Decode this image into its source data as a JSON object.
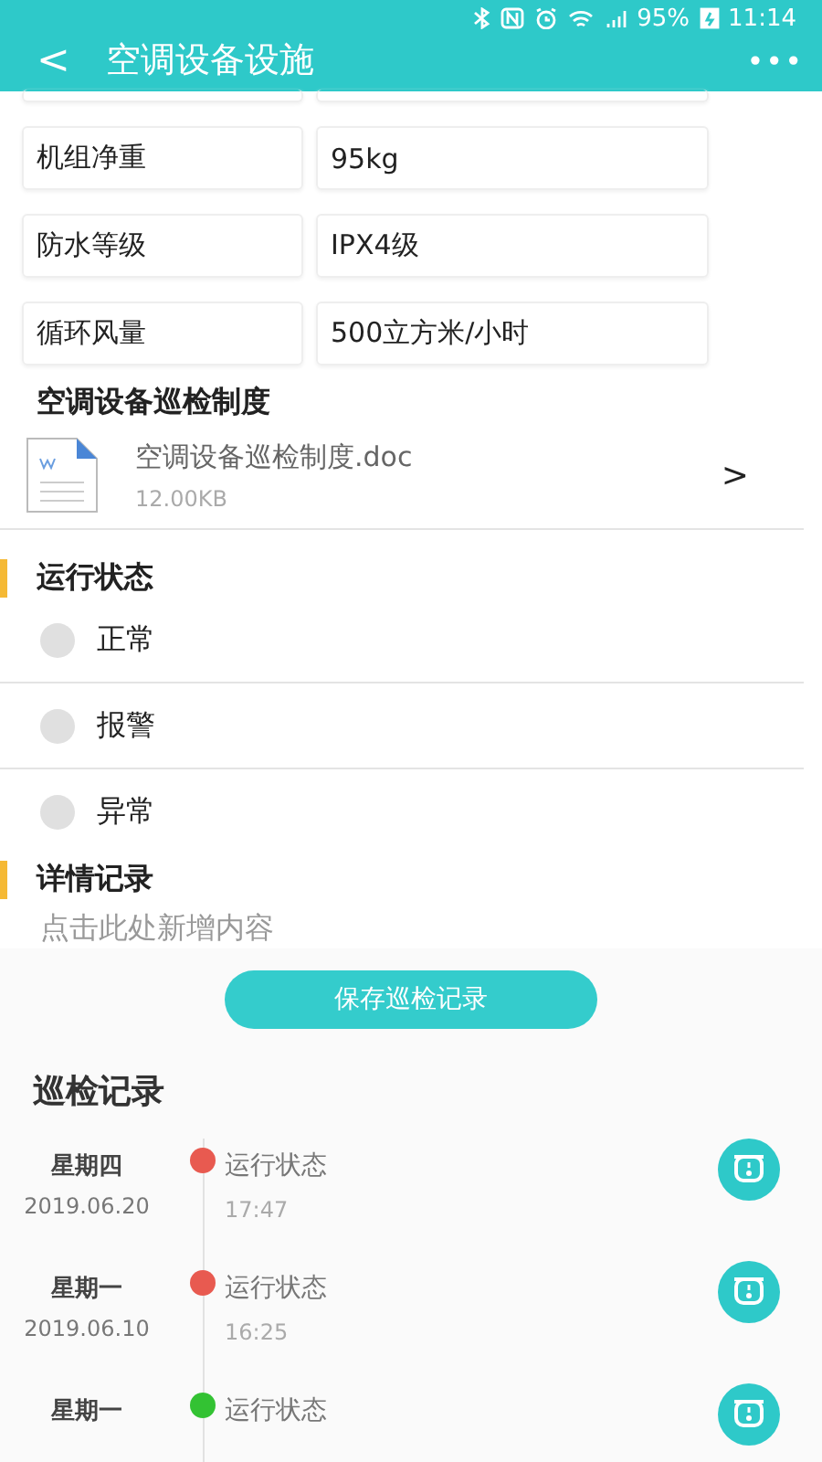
{
  "status_bar": {
    "battery": "95%",
    "time": "11:14"
  },
  "header": {
    "back": "<",
    "title": "空调设备设施",
    "more": "•••"
  },
  "specs": [
    {
      "label": "机组净重",
      "value": "95kg"
    },
    {
      "label": "防水等级",
      "value": "IPX4级"
    },
    {
      "label": "循环风量",
      "value": "500立方米/小时"
    }
  ],
  "document": {
    "heading": "空调设备巡检制度",
    "file_name": "空调设备巡检制度.doc",
    "size": "12.00KB",
    "chevron": ">"
  },
  "status_section": {
    "heading": "运行状态",
    "options": [
      {
        "label": "正常",
        "selected": false
      },
      {
        "label": "报警",
        "selected": false
      },
      {
        "label": "异常",
        "selected": false
      }
    ]
  },
  "details": {
    "heading": "详情记录",
    "placeholder": "点击此处新增内容"
  },
  "save_button": "保存巡检记录",
  "records": {
    "heading": "巡检记录",
    "items": [
      {
        "day": "星期四",
        "date": "2019.06.20",
        "status": "运行状态",
        "time": "17:47",
        "color": "#e85a50"
      },
      {
        "day": "星期一",
        "date": "2019.06.10",
        "status": "运行状态",
        "time": "16:25",
        "color": "#e85a50"
      },
      {
        "day": "星期一",
        "status": "运行状态",
        "color": "#33c233"
      }
    ]
  }
}
